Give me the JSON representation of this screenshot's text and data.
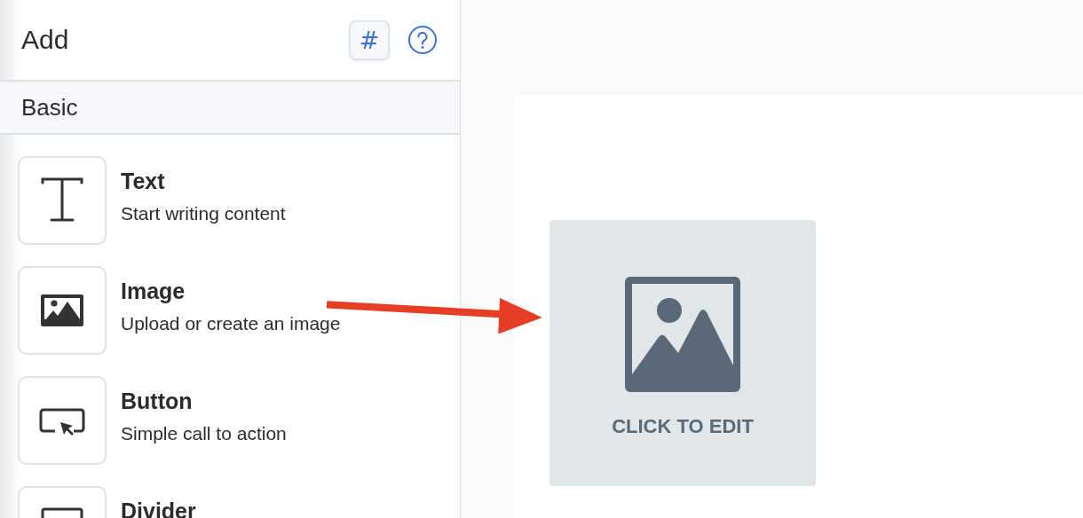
{
  "panel": {
    "title": "Add",
    "hash_button": "#",
    "section": "Basic",
    "items": [
      {
        "kind": "text",
        "title": "Text",
        "subtitle": "Start writing content"
      },
      {
        "kind": "image",
        "title": "Image",
        "subtitle": "Upload or create an image"
      },
      {
        "kind": "button",
        "title": "Button",
        "subtitle": "Simple call to action"
      },
      {
        "kind": "divider",
        "title": "Divider"
      }
    ]
  },
  "canvas": {
    "placeholder": {
      "label": "CLICK TO EDIT"
    }
  }
}
